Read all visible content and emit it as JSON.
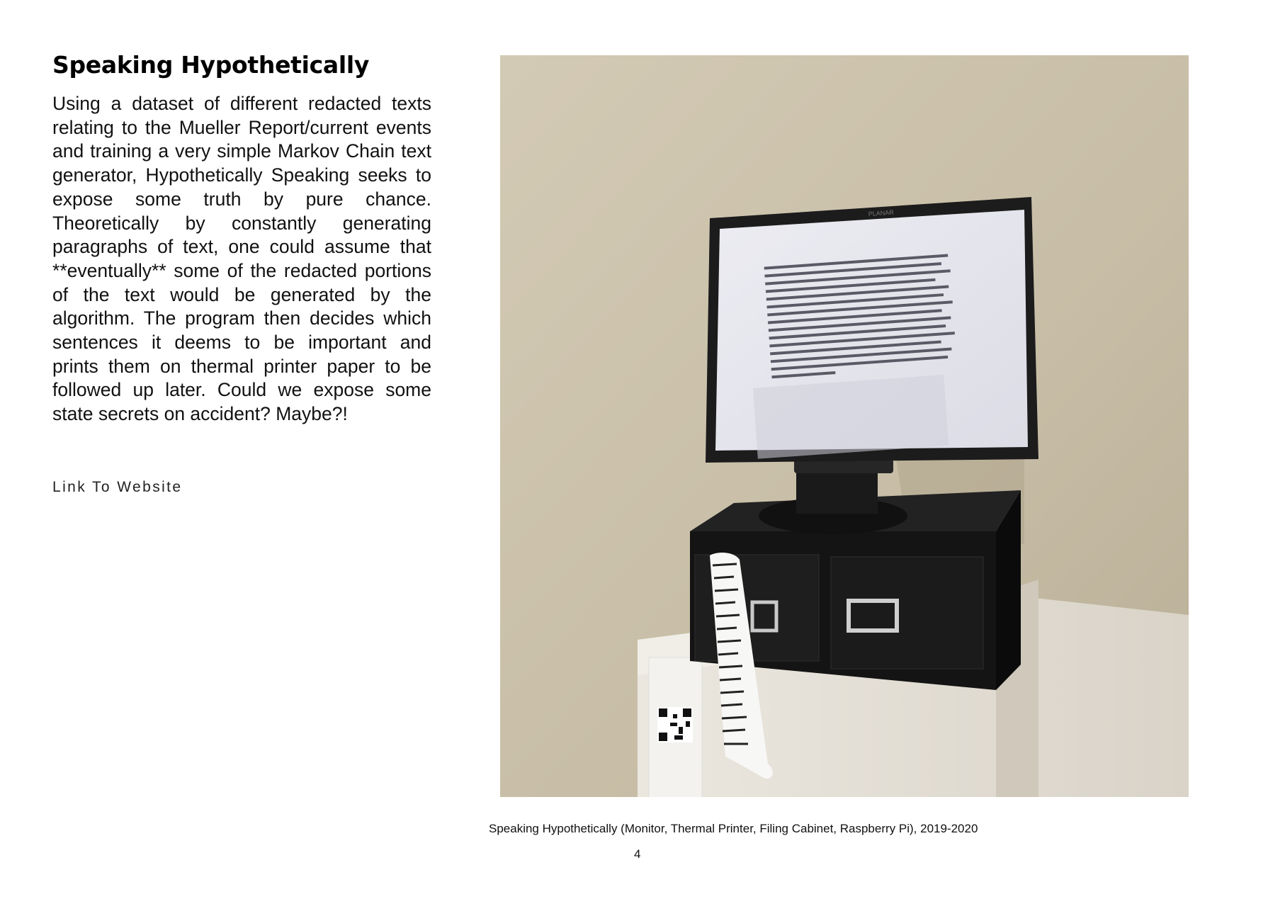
{
  "document": {
    "title": "Speaking Hypothetically",
    "body": "Using a dataset of different redacted texts relating to the Mueller Report/current events and training a very simple Markov Chain text generator, Hypothetically Speaking seeks to expose some truth by pure chance. Theoretically by constantly generating paragraphs of text, one could assume that **eventually** some of the redacted portions of the text would be generated by the algorithm. The program then decides which sentences it deems to be important and prints them on thermal printer paper to be followed up later. Could we expose some state secrets on accident? Maybe?!",
    "link_label": "Link To Website",
    "caption": "Speaking Hypothetically (Monitor, Thermal Printer, Filing Cabinet, Raspberry Pi), 2019-2020",
    "page_number": "4"
  },
  "photo": {
    "monitor_brand": "PLANAR"
  },
  "colors": {
    "wall": "#c9bfa9",
    "pedestal": "#e6e1d8",
    "monitor": "#1c1c1c",
    "screen": "#e9e9ef",
    "cabinet": "#141414"
  }
}
